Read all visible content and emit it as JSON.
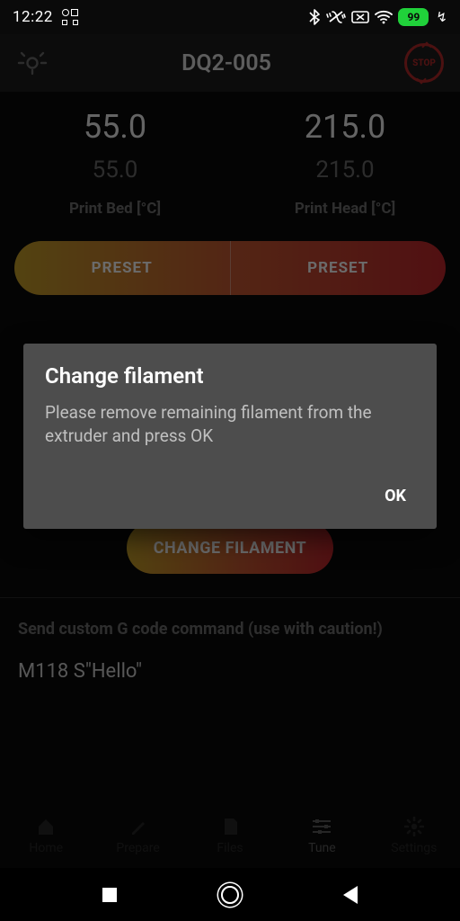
{
  "status": {
    "time": "12:22",
    "battery_pct": "99"
  },
  "header": {
    "title": "DQ2-005",
    "stop_label": "STOP"
  },
  "temps": {
    "bed": {
      "actual": "55.0",
      "target": "55.0",
      "label": "Print Bed [°C]"
    },
    "head": {
      "actual": "215.0",
      "target": "215.0",
      "label": "Print Head [°C]"
    }
  },
  "preset": {
    "left": "PRESET",
    "right": "PRESET"
  },
  "dialog": {
    "title": "Change filament",
    "body": "Please remove remaining filament from the extruder and press OK",
    "ok": "OK"
  },
  "change_filament_btn": "CHANGE FILAMENT",
  "gcode": {
    "label": "Send custom G code command (use with caution!)",
    "value": "M118 S\"Hello\""
  },
  "nav": {
    "home": "Home",
    "prepare": "Prepare",
    "files": "Files",
    "tune": "Tune",
    "settings": "Settings"
  }
}
